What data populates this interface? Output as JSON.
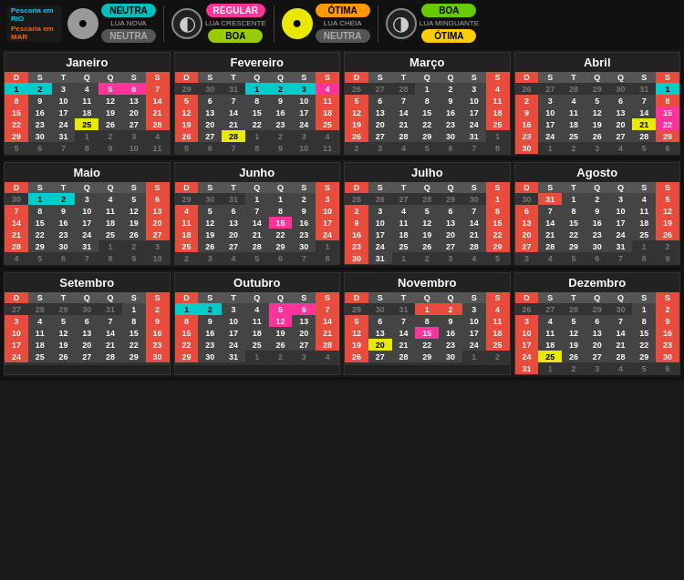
{
  "header": {
    "fish_rio": "Pescaria em RIO",
    "fish_mar": "Pescaria em MAR",
    "groups": [
      {
        "moon_type": "gray",
        "moon_char": "●",
        "top_label": "NEUTRA",
        "top_class": "teal",
        "bottom_label": "NEUTRA",
        "bottom_class": "neutra-dark",
        "moon_label": "LUA NOVA"
      },
      {
        "moon_type": "dark-crescent",
        "moon_char": "◐",
        "top_label": "REGULAR",
        "top_class": "pink",
        "bottom_label": "BOA",
        "bottom_class": "boa-label",
        "moon_label": "LUA CRESCENTE"
      },
      {
        "moon_type": "yellow",
        "moon_char": "●",
        "top_label": "ÓTIMA",
        "top_class": "orange-label",
        "bottom_label": "NEUTRA",
        "bottom_class": "neutra-dark",
        "moon_label": "LUA CHEIA"
      },
      {
        "moon_type": "dark-crescent2",
        "moon_char": "◑",
        "top_label": "BOA",
        "top_class": "green-label",
        "bottom_label": "ÓTIMA",
        "bottom_class": "otima-label",
        "moon_label": "LUA MINGUANTE"
      }
    ]
  },
  "months": [
    {
      "name": "Janeiro",
      "weeks": [
        [
          "1c",
          "2c",
          "3",
          "4",
          "5p",
          "6p",
          "7"
        ],
        [
          "8",
          "9",
          "10",
          "11",
          "12",
          "13",
          "14"
        ],
        [
          "15",
          "16",
          "17",
          "18",
          "19",
          "20",
          "21"
        ],
        [
          "22",
          "23",
          "24",
          "25y",
          "26",
          "27",
          "28"
        ],
        [
          "29",
          "30",
          "31",
          "1e",
          "2e",
          "3e",
          "4e"
        ],
        [
          "5e",
          "6e",
          "7e",
          "8e",
          "9e",
          "10e",
          "11e"
        ]
      ]
    },
    {
      "name": "Fevereiro",
      "weeks": [
        [
          "29e",
          "30e",
          "31e",
          "1c",
          "2c",
          "3c",
          "4p"
        ],
        [
          "5",
          "6",
          "7",
          "8",
          "9",
          "10",
          "11"
        ],
        [
          "12",
          "13",
          "14",
          "15",
          "16",
          "17",
          "18"
        ],
        [
          "19",
          "20",
          "21",
          "22",
          "23",
          "24",
          "25"
        ],
        [
          "26",
          "27",
          "28y",
          "1e",
          "2e",
          "3e",
          "4e"
        ],
        [
          "5e",
          "6e",
          "7e",
          "8e",
          "9e",
          "10e",
          "11e"
        ]
      ]
    },
    {
      "name": "Março",
      "weeks": [
        [
          "26e",
          "27e",
          "28e",
          "1",
          "2",
          "3",
          "4"
        ],
        [
          "5",
          "6",
          "7",
          "8",
          "9",
          "10",
          "11"
        ],
        [
          "12",
          "13",
          "14",
          "15",
          "16",
          "17",
          "18"
        ],
        [
          "19",
          "20",
          "21",
          "22",
          "23",
          "24",
          "25"
        ],
        [
          "26",
          "27",
          "28",
          "29",
          "30",
          "31",
          "1e"
        ],
        [
          "2e",
          "3e",
          "4e",
          "5e",
          "6e",
          "7e",
          "8e"
        ]
      ]
    },
    {
      "name": "Abril",
      "weeks": [
        [
          "26e",
          "27e",
          "28e",
          "29e",
          "30e",
          "31e",
          "1c"
        ],
        [
          "2",
          "3",
          "4",
          "5",
          "6",
          "7",
          "8"
        ],
        [
          "9",
          "10",
          "11",
          "12",
          "13",
          "14",
          "15p"
        ],
        [
          "16r",
          "17",
          "18",
          "19",
          "20",
          "21y",
          "22p"
        ],
        [
          "23",
          "24",
          "25",
          "26",
          "27",
          "28",
          "29"
        ],
        [
          "30",
          "1e",
          "2e",
          "3e",
          "4e",
          "5e",
          "6e"
        ]
      ]
    },
    {
      "name": "Maio",
      "weeks": [
        [
          "30e",
          "1c",
          "2c",
          "3",
          "4",
          "5",
          "6"
        ],
        [
          "7",
          "8",
          "9",
          "10",
          "11",
          "12",
          "13"
        ],
        [
          "14",
          "15",
          "16",
          "17",
          "18",
          "19",
          "20"
        ],
        [
          "21",
          "22",
          "23",
          "24",
          "25",
          "26",
          "27"
        ],
        [
          "28",
          "29",
          "30",
          "31",
          "1e",
          "2e",
          "3e"
        ],
        [
          "4e",
          "5e",
          "6e",
          "7e",
          "8e",
          "9e",
          "10e"
        ]
      ]
    },
    {
      "name": "Junho",
      "weeks": [
        [
          "29e",
          "30e",
          "31e",
          "1",
          "1",
          "2",
          "3"
        ],
        [
          "4",
          "5",
          "6",
          "7",
          "8",
          "9",
          "10"
        ],
        [
          "11",
          "12",
          "13",
          "14",
          "15p",
          "16",
          "17"
        ],
        [
          "18",
          "19",
          "20",
          "21",
          "22",
          "23",
          "24"
        ],
        [
          "25",
          "26",
          "27",
          "28",
          "29",
          "30",
          "1e"
        ],
        [
          "2e",
          "3e",
          "4e",
          "5e",
          "6e",
          "7e",
          "8e"
        ]
      ]
    },
    {
      "name": "Julho",
      "weeks": [
        [
          "25e",
          "26e",
          "27e",
          "28e",
          "29e",
          "30e",
          "1"
        ],
        [
          "2",
          "3",
          "4",
          "5",
          "6",
          "7",
          "8"
        ],
        [
          "9",
          "10",
          "11",
          "12",
          "13",
          "14",
          "15"
        ],
        [
          "16",
          "17",
          "18",
          "19",
          "20",
          "21",
          "22"
        ],
        [
          "23",
          "24",
          "25",
          "26",
          "27",
          "28",
          "29"
        ],
        [
          "30",
          "31",
          "1e",
          "2e",
          "3e",
          "4e",
          "5e"
        ]
      ]
    },
    {
      "name": "Agosto",
      "weeks": [
        [
          "30e",
          "31r",
          "1",
          "2",
          "3",
          "4",
          "5"
        ],
        [
          "6",
          "7",
          "8",
          "9",
          "10",
          "11",
          "12"
        ],
        [
          "13",
          "14",
          "15",
          "16",
          "17",
          "18",
          "19"
        ],
        [
          "20",
          "21",
          "22",
          "23",
          "24",
          "25",
          "26"
        ],
        [
          "27",
          "28",
          "29",
          "30",
          "31",
          "1e",
          "2e"
        ],
        [
          "3e",
          "4e",
          "5e",
          "6e",
          "7e",
          "8e",
          "9e"
        ]
      ]
    },
    {
      "name": "Setembro",
      "weeks": [
        [
          "27e",
          "28e",
          "29e",
          "30e",
          "31e",
          "1",
          "2"
        ],
        [
          "3",
          "4",
          "5",
          "6",
          "7",
          "8",
          "9"
        ],
        [
          "10",
          "11",
          "12",
          "13",
          "14",
          "15",
          "16"
        ],
        [
          "17",
          "18",
          "19",
          "20",
          "21",
          "22",
          "23"
        ],
        [
          "24",
          "25",
          "26",
          "27",
          "28",
          "29",
          "30"
        ],
        [
          "",
          "",
          "",
          "",
          "",
          "",
          ""
        ]
      ]
    },
    {
      "name": "Outubro",
      "weeks": [
        [
          "1c",
          "2c",
          "3",
          "4",
          "5p",
          "6p",
          "7"
        ],
        [
          "8",
          "9",
          "10",
          "11",
          "12p",
          "13",
          "14"
        ],
        [
          "15",
          "16",
          "17",
          "18",
          "19",
          "20",
          "21"
        ],
        [
          "22",
          "23",
          "24",
          "25",
          "26",
          "27",
          "28"
        ],
        [
          "29",
          "30",
          "31",
          "1e",
          "2e",
          "3e",
          "4e"
        ],
        [
          "",
          "",
          "",
          "",
          "",
          "",
          ""
        ]
      ]
    },
    {
      "name": "Novembro",
      "weeks": [
        [
          "29e",
          "30e",
          "31e",
          "1r",
          "2r",
          "3",
          "4"
        ],
        [
          "5",
          "6",
          "7",
          "8",
          "9",
          "10",
          "11"
        ],
        [
          "12",
          "13",
          "14",
          "15p",
          "16",
          "17",
          "18"
        ],
        [
          "19",
          "20y",
          "21",
          "22",
          "23",
          "24",
          "25"
        ],
        [
          "26",
          "27",
          "28",
          "29",
          "30",
          "1e",
          "2e"
        ],
        [
          "",
          "",
          "",
          "",
          "",
          "",
          ""
        ]
      ]
    },
    {
      "name": "Dezembro",
      "weeks": [
        [
          "26e",
          "27e",
          "28e",
          "29e",
          "30e",
          "1",
          "2"
        ],
        [
          "3",
          "4",
          "5",
          "6",
          "7",
          "8",
          "9"
        ],
        [
          "10",
          "11",
          "12",
          "13",
          "14",
          "15",
          "16"
        ],
        [
          "17",
          "18",
          "19",
          "20",
          "21",
          "22",
          "23"
        ],
        [
          "24",
          "25y",
          "26",
          "27",
          "28",
          "29",
          "30"
        ],
        [
          "31",
          "1e",
          "2e",
          "3e",
          "4e",
          "5e",
          "6e"
        ]
      ]
    }
  ]
}
